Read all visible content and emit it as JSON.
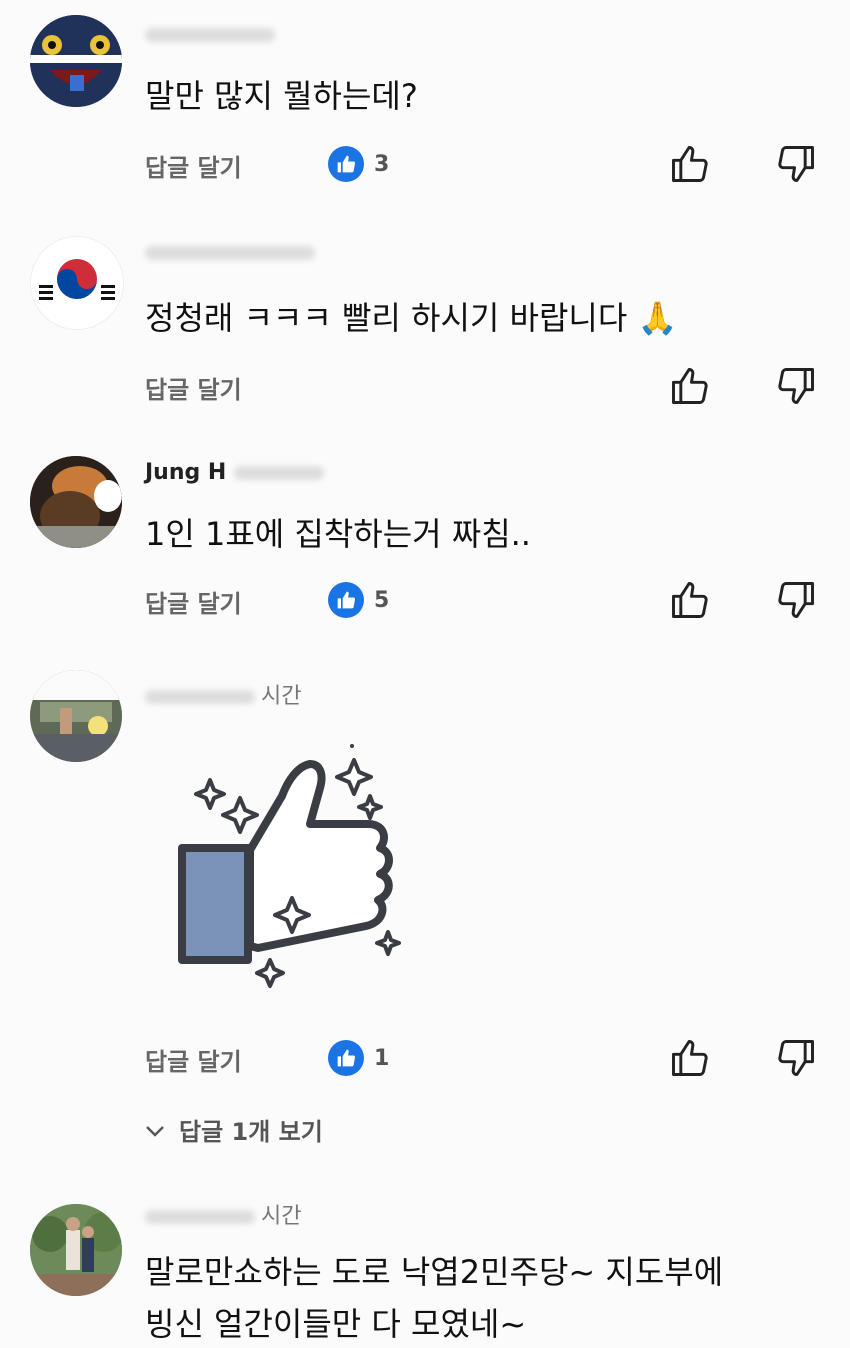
{
  "common": {
    "reply_label": "답글 달기",
    "like_icon": "thumbs-up-outline-icon",
    "dislike_icon": "thumbs-down-outline-icon",
    "reaction_icon": "facebook-like-badge-icon",
    "accent": "#1b74e4"
  },
  "comments": [
    {
      "meta": "",
      "text": "말만 많지 뭘하는데?",
      "likes": "3"
    },
    {
      "meta": "",
      "text": "정청래 ㅋㅋㅋ 빨리 하시기 바랍니다 🙏",
      "likes": ""
    },
    {
      "meta": "Jung H",
      "text": "1인 1표에 집착하는거 짜침..",
      "likes": "5"
    },
    {
      "meta": "시간",
      "sticker": "thumbs-up-sparkle-sticker",
      "likes": "1",
      "view_replies": "답글 1개 보기"
    },
    {
      "meta": "시간",
      "text_line1": "말로만쇼하는 도로 낙엽2민주당~ 지도부에",
      "text_line2": "빙신 얼간이들만 다 모였네~"
    }
  ]
}
